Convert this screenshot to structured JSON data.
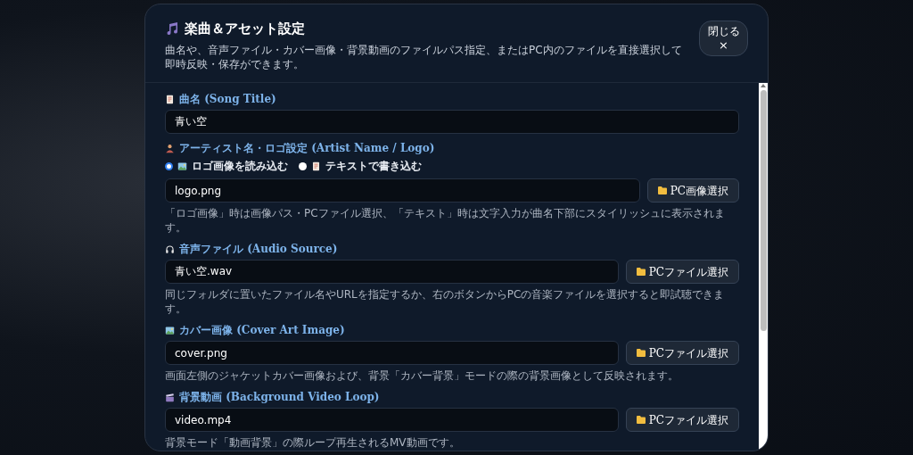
{
  "dialog": {
    "title": "楽曲＆アセット設定",
    "description": "曲名や、音声ファイル・カバー画像・背景動画のファイルパス指定、またはPC内のファイルを直接選択して即時反映・保存ができます。",
    "close_button": {
      "label": "閉じる",
      "symbol": "×"
    }
  },
  "sections": [
    {
      "kind": "text",
      "label": "曲名 (Song Title)",
      "value": "青い空"
    },
    {
      "kind": "radio",
      "label": "アーティスト名・ロゴ設定 (Artist Name / Logo)",
      "options": [
        {
          "label": "ロゴ画像を読み込む",
          "selected": true
        },
        {
          "label": "テキストで書き込む",
          "selected": false
        }
      ],
      "value": "logo.png",
      "button": "PC画像選択",
      "hint": "「ロゴ画像」時は画像パス・PCファイル選択、「テキスト」時は文字入力が曲名下部にスタイリッシュに表示されます。"
    },
    {
      "kind": "file",
      "label": "音声ファイル (Audio Source)",
      "value": "青い空.wav",
      "button": "PCファイル選択",
      "hint": "同じフォルダに置いたファイル名やURLを指定するか、右のボタンからPCの音楽ファイルを選択すると即試聴できます。"
    },
    {
      "kind": "file",
      "label": "カバー画像 (Cover Art Image)",
      "value": "cover.png",
      "button": "PCファイル選択",
      "hint": "画面左側のジャケットカバー画像および、背景「カバー背景」モードの際の背景画像として反映されます。"
    },
    {
      "kind": "file",
      "label": "背景動画 (Background Video Loop)",
      "value": "video.mp4",
      "button": "PCファイル選択",
      "hint": "背景モード「動画背景」の際ループ再生されるMV動画です。"
    }
  ]
}
